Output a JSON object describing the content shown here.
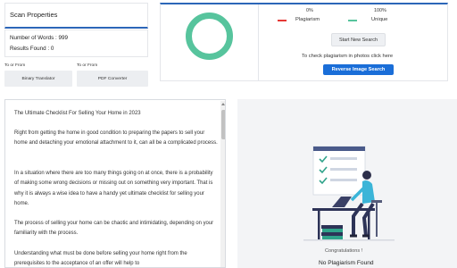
{
  "scan_properties": {
    "title": "Scan Properties",
    "words_label": "Number of Words : 999",
    "results_label": "Results Found : 0"
  },
  "tools": [
    {
      "caption": "To or From",
      "button": "Binary Translator"
    },
    {
      "caption": "To or From",
      "button": "PDF Converter"
    }
  ],
  "result": {
    "plagiarism_pct": "0%",
    "unique_pct": "100%",
    "plagiarism_label": "Plagiarism",
    "unique_label": "Unique",
    "start_button": "Start New Search",
    "photo_hint": "To check plagiarism in photos click here",
    "reverse_button": "Reverse Image Search",
    "unique_fraction": 1.0
  },
  "colors": {
    "accent": "#2c66b8",
    "plagiarism": "#e53935",
    "unique": "#57c49d",
    "reverse_button": "#1a6ed8"
  },
  "document": {
    "paragraphs": [
      "The Ultimate Checklist For Selling Your Home in 2023",
      "Right from getting the home in good condition to preparing the papers to sell your home and detaching your emotional attachment to it, can all be a complicated process.",
      "In a situation where there are too many things going on at once, there is a probability of making some wrong decisions or missing out on something very important. That is why it is always a wise idea to have a handy yet ultimate checklist for selling your home.",
      "The process of selling your home can be chaotic and intimidating, depending on your familiarity with the process.",
      "Understanding what must be done before selling your home right from the prerequisites to the acceptance of an offer will help to"
    ]
  },
  "outcome": {
    "congrats": "Congratulations !",
    "message": "No Plagiarism Found",
    "illustration_icon": "person-at-laptop-checklist-illustration"
  }
}
